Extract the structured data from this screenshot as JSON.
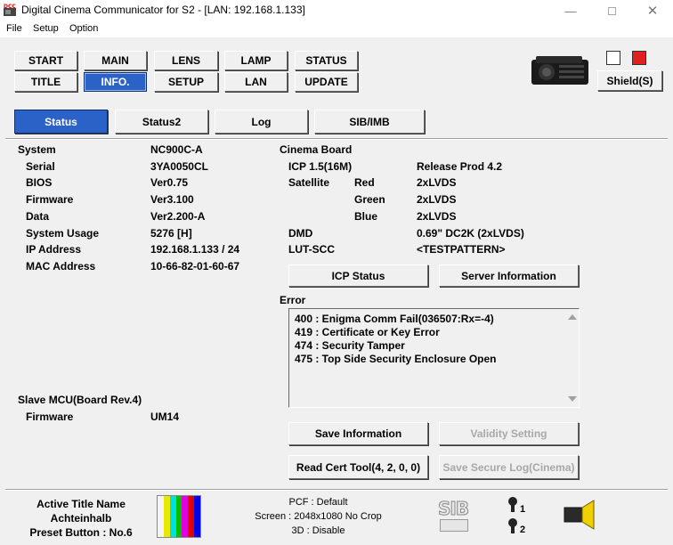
{
  "window": {
    "title": "Digital Cinema Communicator for S2 - [LAN: 192.168.1.133]",
    "app_icon_text": "DCC"
  },
  "menu": [
    "File",
    "Setup",
    "Option"
  ],
  "nav_row1": [
    "START",
    "MAIN",
    "LENS",
    "LAMP",
    "STATUS"
  ],
  "nav_row2": [
    "TITLE",
    "INFO.",
    "SETUP",
    "LAN",
    "UPDATE"
  ],
  "shield_label": "Shield(S)",
  "tabs": [
    "Status",
    "Status2",
    "Log",
    "SIB/IMB"
  ],
  "system": {
    "heading": "System",
    "model": "NC900C-A",
    "rows": [
      {
        "label": "Serial",
        "value": "3YA0050CL"
      },
      {
        "label": "BIOS",
        "value": "Ver0.75"
      },
      {
        "label": "Firmware",
        "value": "Ver3.100"
      },
      {
        "label": "Data",
        "value": "Ver2.200-A"
      },
      {
        "label": "System Usage",
        "value": "5276 [H]"
      },
      {
        "label": "IP Address",
        "value": "192.168.1.133 / 24"
      },
      {
        "label": "MAC Address",
        "value": "10-66-82-01-60-67"
      }
    ]
  },
  "slave": {
    "heading": "Slave MCU(Board Rev.4)",
    "firmware_label": "Firmware",
    "firmware_value": "UM14"
  },
  "cinema": {
    "heading": "Cinema Board",
    "icp_label": "ICP 1.5(16M)",
    "icp_value": "Release Prod 4.2",
    "satellite_label": "Satellite",
    "satellite": [
      {
        "color": "Red",
        "value": "2xLVDS"
      },
      {
        "color": "Green",
        "value": "2xLVDS"
      },
      {
        "color": "Blue",
        "value": "2xLVDS"
      }
    ],
    "dmd_label": "DMD",
    "dmd_value": "0.69\" DC2K (2xLVDS)",
    "lut_label": "LUT-SCC",
    "lut_value": "<TESTPATTERN>",
    "icp_status_button": "ICP Status",
    "server_info_button": "Server Information"
  },
  "error": {
    "heading": "Error",
    "lines": [
      "400 : Enigma Comm Fail(036507:Rx=-4)",
      "419 : Certificate or Key Error",
      "474 : Security Tamper",
      "475 : Top Side Security Enclosure Open"
    ]
  },
  "actions": {
    "save_information": "Save Information",
    "validity_setting": "Validity Setting",
    "read_cert_tool": "Read Cert Tool(4, 2, 0, 0)",
    "save_secure_log": "Save Secure Log(Cinema)"
  },
  "bottom": {
    "active_title_label": "Active Title Name",
    "active_title_value": "Achteinhalb",
    "preset_button": "Preset Button : No.6",
    "pcf": "PCF : Default",
    "screen": "Screen : 2048x1080 No Crop",
    "threed": "3D : Disable",
    "sib_text": "SIB",
    "indicator1": "1",
    "indicator2": "2"
  },
  "colors": {
    "active_blue": "#2a62c8",
    "status_red": "#e02020",
    "colorbars": [
      "#f4f4f4",
      "#e8e800",
      "#00e0e0",
      "#00c000",
      "#e000e0",
      "#e00000",
      "#0000e0"
    ]
  }
}
